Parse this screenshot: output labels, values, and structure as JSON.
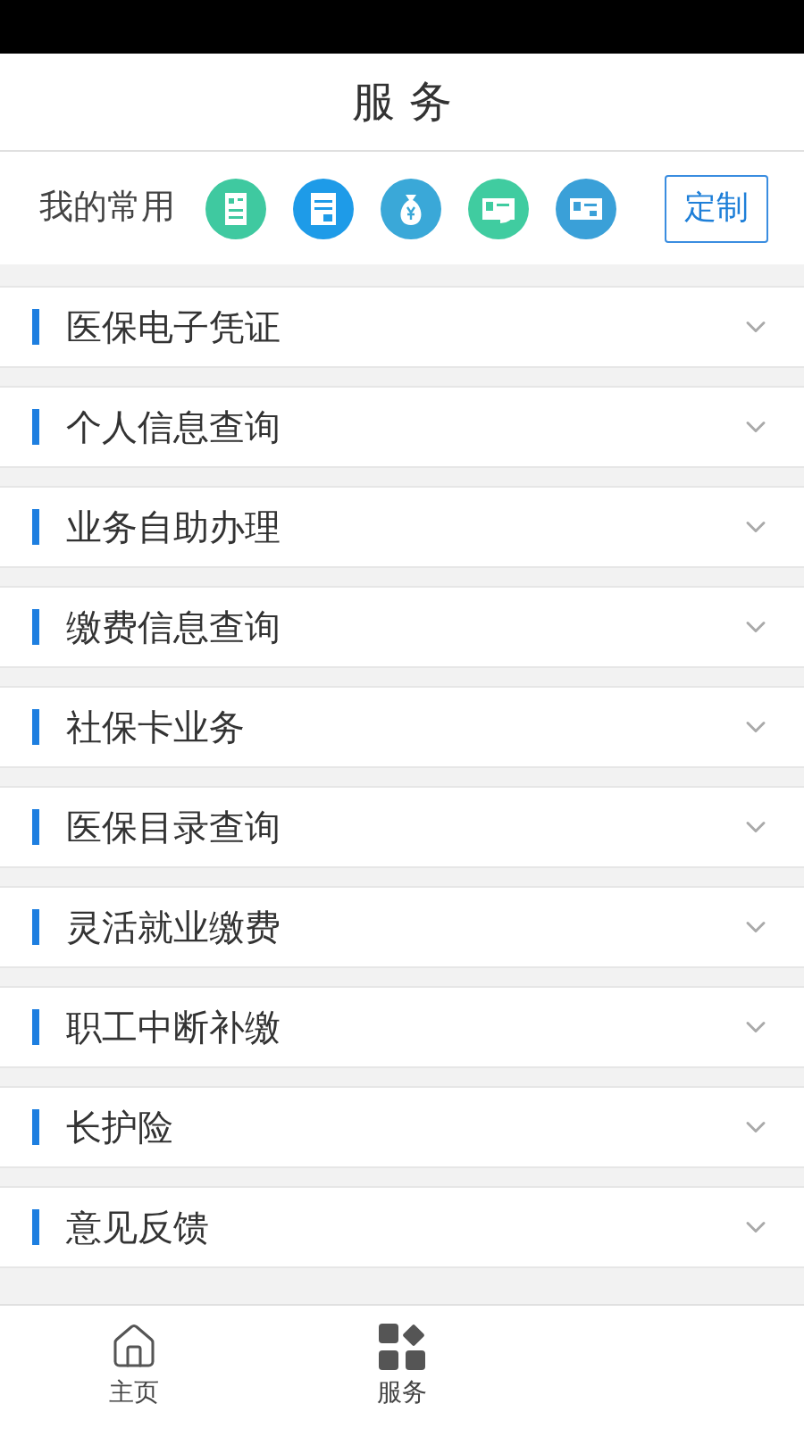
{
  "header": {
    "title": "服 务"
  },
  "favorites": {
    "label": "我的常用",
    "icons": [
      {
        "kind": "form"
      },
      {
        "kind": "document"
      },
      {
        "kind": "money"
      },
      {
        "kind": "card"
      },
      {
        "kind": "id"
      }
    ],
    "button": "定制"
  },
  "menu": [
    {
      "label": "医保电子凭证",
      "expanded": false
    },
    {
      "label": "个人信息查询",
      "expanded": false
    },
    {
      "label": "业务自助办理",
      "expanded": false
    },
    {
      "label": "缴费信息查询",
      "expanded": false
    },
    {
      "label": "社保卡业务",
      "expanded": false
    },
    {
      "label": "医保目录查询",
      "expanded": false
    },
    {
      "label": "灵活就业缴费",
      "expanded": false
    },
    {
      "label": "职工中断补缴",
      "expanded": false
    },
    {
      "label": "长护险",
      "expanded": false
    },
    {
      "label": "意见反馈",
      "expanded": false
    }
  ],
  "tabbar": [
    {
      "label": "主页",
      "kind": "home"
    },
    {
      "label": "服务",
      "kind": "grid"
    }
  ]
}
